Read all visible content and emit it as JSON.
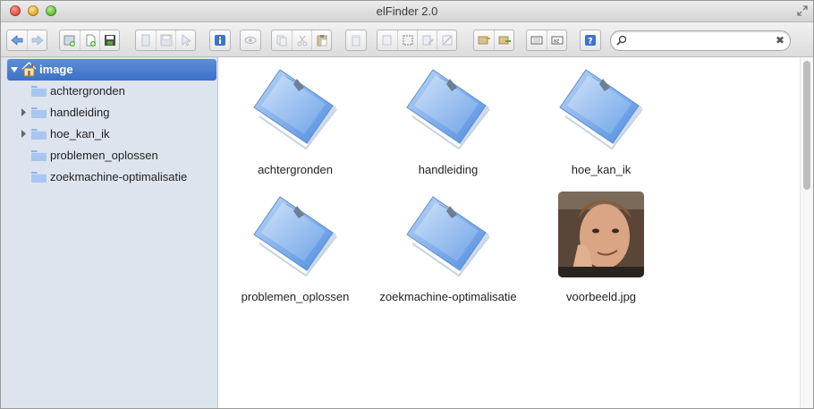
{
  "window": {
    "title": "elFinder 2.0"
  },
  "search": {
    "placeholder": "",
    "value": "",
    "clear_label": "✖"
  },
  "tree": {
    "root": {
      "label": "image"
    },
    "children": [
      {
        "label": "achtergronden",
        "expandable": false
      },
      {
        "label": "handleiding",
        "expandable": true
      },
      {
        "label": "hoe_kan_ik",
        "expandable": true
      },
      {
        "label": "problemen_oplossen",
        "expandable": false
      },
      {
        "label": "zoekmachine-optimalisatie",
        "expandable": false
      }
    ]
  },
  "files": [
    {
      "name": "achtergronden",
      "type": "folder"
    },
    {
      "name": "handleiding",
      "type": "folder"
    },
    {
      "name": "hoe_kan_ik",
      "type": "folder"
    },
    {
      "name": "problemen_oplossen",
      "type": "folder"
    },
    {
      "name": "zoekmachine-optimalisatie",
      "type": "folder"
    },
    {
      "name": "voorbeeld.jpg",
      "type": "image"
    }
  ],
  "colors": {
    "selection": "#4a80d0",
    "tree_bg": "#dee4ee",
    "help_blue": "#3f73c9"
  }
}
